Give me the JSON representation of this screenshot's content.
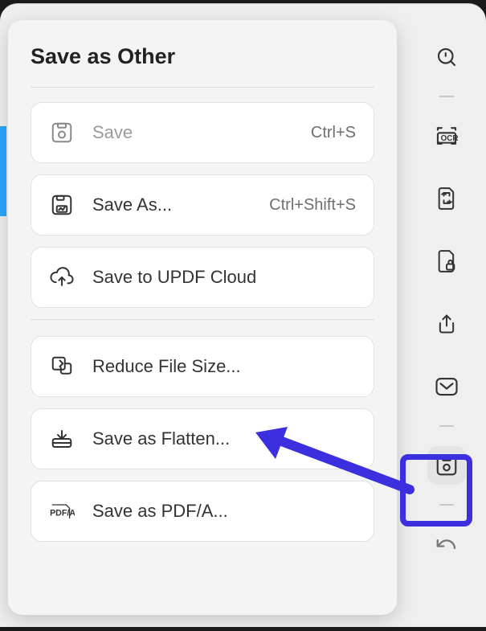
{
  "panel": {
    "title": "Save as Other",
    "options": [
      {
        "key": "save",
        "label": "Save",
        "shortcut": "Ctrl+S",
        "icon": "disk-icon",
        "disabled": true
      },
      {
        "key": "save-as",
        "label": "Save As...",
        "shortcut": "Ctrl+Shift+S",
        "icon": "disk-image-icon",
        "disabled": false
      },
      {
        "key": "cloud",
        "label": "Save to UPDF Cloud",
        "shortcut": "",
        "icon": "cloud-upload-icon",
        "disabled": false
      },
      {
        "key": "reduce",
        "label": "Reduce File Size...",
        "shortcut": "",
        "icon": "file-shrink-icon",
        "disabled": false
      },
      {
        "key": "flatten",
        "label": "Save as Flatten...",
        "shortcut": "",
        "icon": "tray-down-icon",
        "disabled": false
      },
      {
        "key": "pdfa",
        "label": "Save as PDF/A...",
        "shortcut": "",
        "icon": "pdfa-icon",
        "disabled": false
      }
    ]
  },
  "sidebar": {
    "items": [
      {
        "key": "search",
        "icon": "search-icon"
      },
      {
        "key": "ocr",
        "icon": "ocr-icon"
      },
      {
        "key": "convert",
        "icon": "page-arrows-icon"
      },
      {
        "key": "protect",
        "icon": "page-lock-icon"
      },
      {
        "key": "share",
        "icon": "share-icon"
      },
      {
        "key": "mail",
        "icon": "envelope-icon"
      },
      {
        "key": "save",
        "icon": "disk-icon",
        "active": true
      },
      {
        "key": "undo",
        "icon": "undo-icon"
      }
    ]
  }
}
